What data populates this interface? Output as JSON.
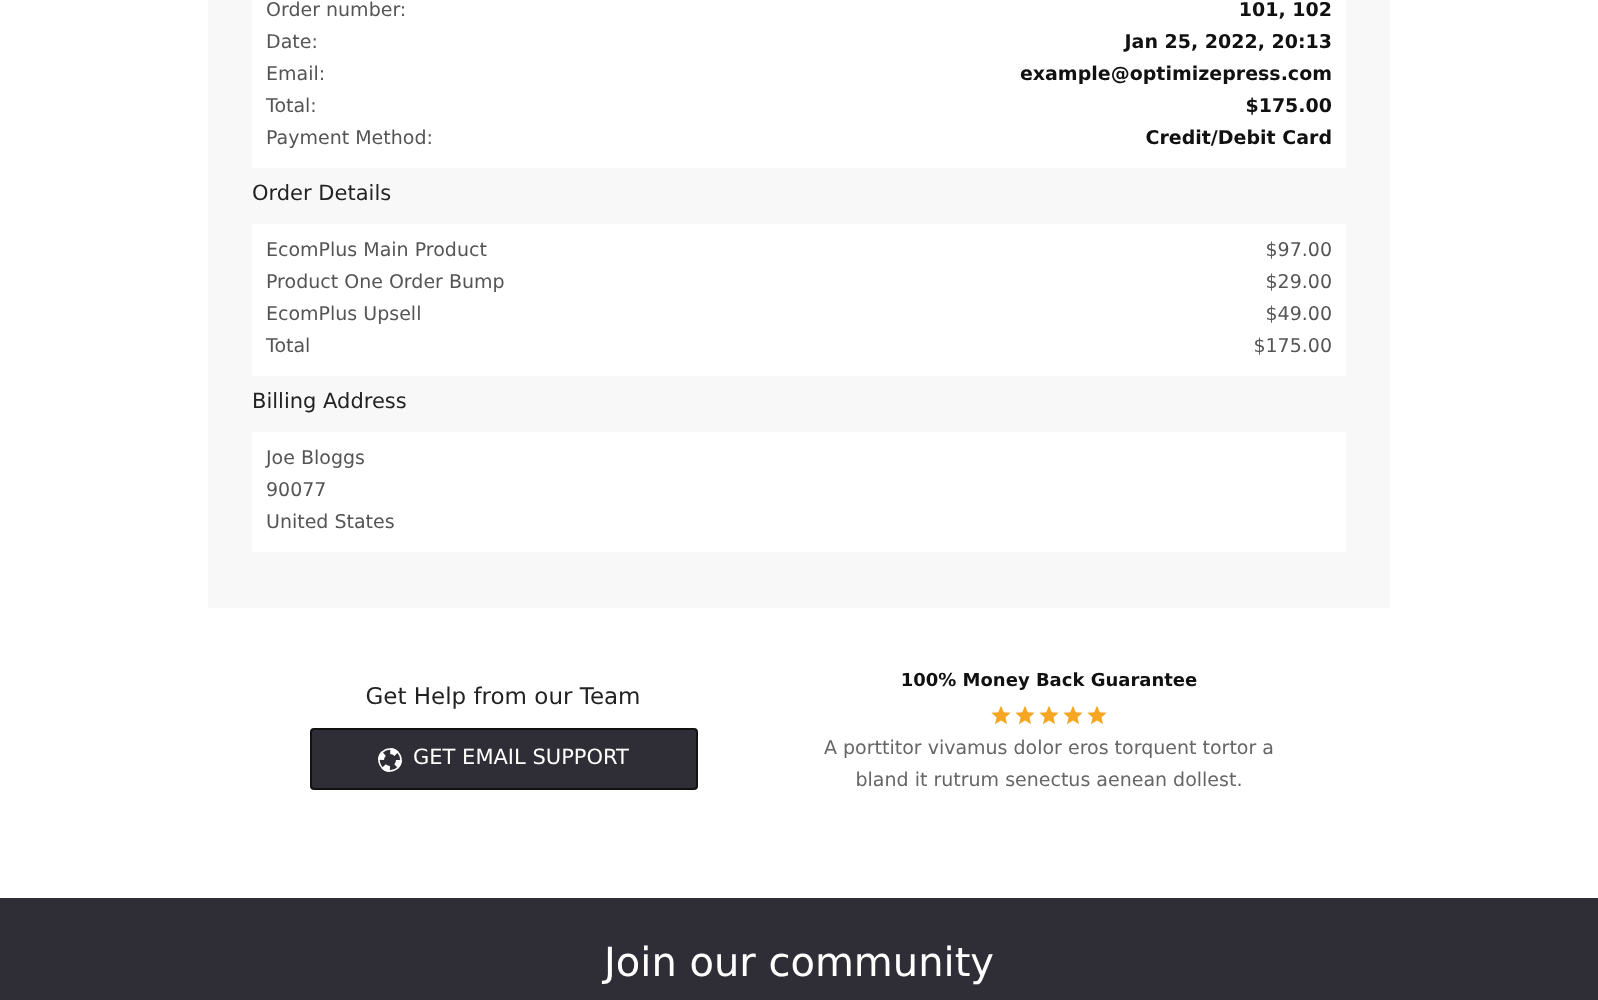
{
  "order_summary": {
    "rows": [
      {
        "label": "Order number:",
        "value": "101, 102"
      },
      {
        "label": "Date:",
        "value": "Jan 25, 2022, 20:13"
      },
      {
        "label": "Email:",
        "value": "example@optimizepress.com"
      },
      {
        "label": "Total:",
        "value": "$175.00"
      },
      {
        "label": "Payment Method:",
        "value": "Credit/Debit Card"
      }
    ]
  },
  "order_details": {
    "heading": "Order Details",
    "rows": [
      {
        "label": "EcomPlus Main Product",
        "value": "$97.00"
      },
      {
        "label": "Product One Order Bump",
        "value": "$29.00"
      },
      {
        "label": "EcomPlus Upsell",
        "value": "$49.00"
      },
      {
        "label": "Total",
        "value": "$175.00"
      }
    ]
  },
  "billing_address": {
    "heading": "Billing Address",
    "lines": [
      "Joe Bloggs",
      "90077",
      "United States"
    ]
  },
  "help": {
    "heading": "Get Help from our Team",
    "button": "GET EMAIL SUPPORT"
  },
  "guarantee": {
    "title": "100% Money Back Guarantee",
    "stars": 5,
    "text": "A porttitor vivamus dolor eros torquent tortor a bland it rutrum senectus aenean dollest."
  },
  "footer": {
    "heading": "Join our community"
  }
}
